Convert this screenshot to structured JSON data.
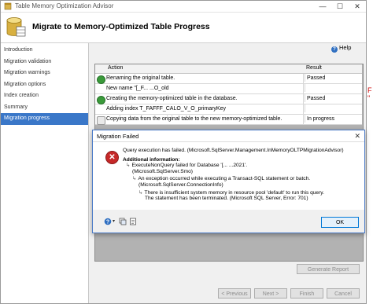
{
  "window": {
    "title": "Table Memory Optimization Advisor",
    "page_title": "Migrate to Memory-Optimized Table Progress"
  },
  "help": {
    "label": "Help"
  },
  "sidebar": {
    "items": [
      {
        "label": "Introduction"
      },
      {
        "label": "Migration validation"
      },
      {
        "label": "Migration warnings"
      },
      {
        "label": "Migration options"
      },
      {
        "label": "Index creation"
      },
      {
        "label": "Summary"
      },
      {
        "label": "Migration progress"
      }
    ]
  },
  "grid": {
    "col_action": "Action",
    "col_result": "Result",
    "rows": [
      {
        "action": "Renaming the original table.",
        "result": "Passed",
        "status": "passed"
      },
      {
        "action": "New name \"[_F...            ...O_old",
        "result": "",
        "status": "none"
      },
      {
        "action": "Creating the memory-optimized table in the database.",
        "result": "Passed",
        "status": "passed"
      },
      {
        "action": "Adding index T_FAFFF_CALO_V_O_primaryKey",
        "result": "",
        "status": "none"
      },
      {
        "action": "Copying data from the original table to the new memory-optimized table.",
        "result": "In progress",
        "status": "progress"
      }
    ]
  },
  "buttons": {
    "generate_report": "Generate Report",
    "previous": "< Previous",
    "next": "Next >",
    "finish": "Finish",
    "cancel": "Cancel"
  },
  "dialog": {
    "title": "Migration Failed",
    "main_message": "Query execution has failed. (Microsoft.SqlServer.Management.InMemoryOLTPMigrationAdvisor)",
    "additional_info_label": "Additional information:",
    "line1": "ExecuteNonQuery failed for Database '[...               ...2021'.",
    "line1b": "(Microsoft.SqlServer.Smo)",
    "line2": "An exception occurred while executing a Transact-SQL statement or batch.",
    "line2b": "(Microsoft.SqlServer.ConnectionInfo)",
    "line3": "There is insufficient system memory in resource pool 'default' to run this query.",
    "line3b": "The statement has been terminated. (Microsoft SQL Server, Error: 701)",
    "ok_label": "OK",
    "footer_icons": [
      "help-icon",
      "copy-icon",
      "details-icon"
    ]
  },
  "background_text": "F \""
}
